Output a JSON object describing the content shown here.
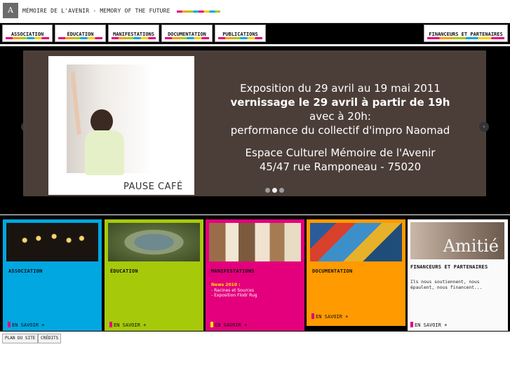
{
  "header": {
    "logo_text": "A",
    "title": "MÉMOIRE DE L'AVENIR - MEMORY OF THE FUTURE"
  },
  "nav": {
    "items": [
      "ASSOCIATION",
      "ÉDUCATION",
      "MANIFESTATIONS",
      "DOCUMENTATION",
      "PUBLICATIONS",
      "FINANCEURS ET PARTENAIRES"
    ]
  },
  "slider": {
    "photo_caption": "PAUSE CAFÉ",
    "lines": [
      "Exposition du 29 avril au 19 mai 2011",
      "vernissage le 29 avril à partir de 19h",
      "avec à 20h:",
      "performance du collectif d'impro Naomad",
      "Espace Culturel Mémoire de l'Avenir",
      "45/47 rue Ramponeau - 75020"
    ],
    "prev_arrow": "‹",
    "next_arrow": "›"
  },
  "tiles": [
    {
      "title": "ASSOCIATION",
      "more": "EN SAVOIR +",
      "color": "#00a7e1"
    },
    {
      "title": "ÉDUCATION",
      "more": "EN SAVOIR +",
      "color": "#a6c90a"
    },
    {
      "title": "MANIFESTATIONS",
      "more": "EN SAVOIR +",
      "color": "#e4007c",
      "news_title": "News 2010 :",
      "news_line1": "- Racines et Sources",
      "news_line2": "- Exposition Flodr Rug"
    },
    {
      "title": "DOCUMENTATION",
      "more": "EN SAVOIR +",
      "color": "#ff9a00"
    },
    {
      "title": "FINANCEURS ET PARTENAIRES",
      "more": "EN SAVOIR +",
      "color": "#ffffff",
      "text": "Ils nous soutiennent, nous épaulent, nous financent...",
      "image_text": "Amitié"
    }
  ],
  "footer": {
    "sitemap": "PLAN DU SITE",
    "credits": "CRÉDITS"
  }
}
